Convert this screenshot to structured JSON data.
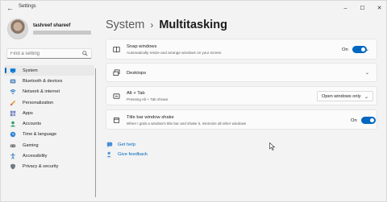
{
  "window": {
    "title": "Settings",
    "controls": [
      "–",
      "☐",
      "✕"
    ]
  },
  "profile": {
    "name": "tashreef shareef"
  },
  "search": {
    "placeholder": "Find a setting"
  },
  "nav": [
    {
      "label": "System",
      "icon": "monitor-icon",
      "active": true
    },
    {
      "label": "Bluetooth & devices",
      "icon": "bluetooth-icon"
    },
    {
      "label": "Network & internet",
      "icon": "wifi-icon"
    },
    {
      "label": "Personalization",
      "icon": "brush-icon"
    },
    {
      "label": "Apps",
      "icon": "apps-icon"
    },
    {
      "label": "Accounts",
      "icon": "person-icon"
    },
    {
      "label": "Time & language",
      "icon": "globe-clock-icon"
    },
    {
      "label": "Gaming",
      "icon": "gamepad-icon"
    },
    {
      "label": "Accessibility",
      "icon": "accessibility-icon"
    },
    {
      "label": "Privacy & security",
      "icon": "shield-icon"
    }
  ],
  "breadcrumb": {
    "parent": "System",
    "separator": "›",
    "current": "Multitasking"
  },
  "cards": {
    "snap": {
      "title": "Snap windows",
      "desc": "Automatically resize and arrange windows on your screen",
      "toggle_label": "On",
      "toggle_on": true
    },
    "desktops": {
      "title": "Desktops"
    },
    "alttab": {
      "title": "Alt + Tab",
      "desc": "Pressing Alt + Tab shows",
      "dropdown_value": "Open windows only"
    },
    "shake": {
      "title": "Title bar window shake",
      "desc": "When I grab a window's title bar and shake it, minimize all other windows",
      "toggle_label": "On",
      "toggle_on": true
    }
  },
  "links": {
    "help": "Get help",
    "feedback": "Give feedback"
  },
  "colors": {
    "accent": "#0067c0",
    "background": "#f3f3f3",
    "card": "#fbfbfb"
  }
}
